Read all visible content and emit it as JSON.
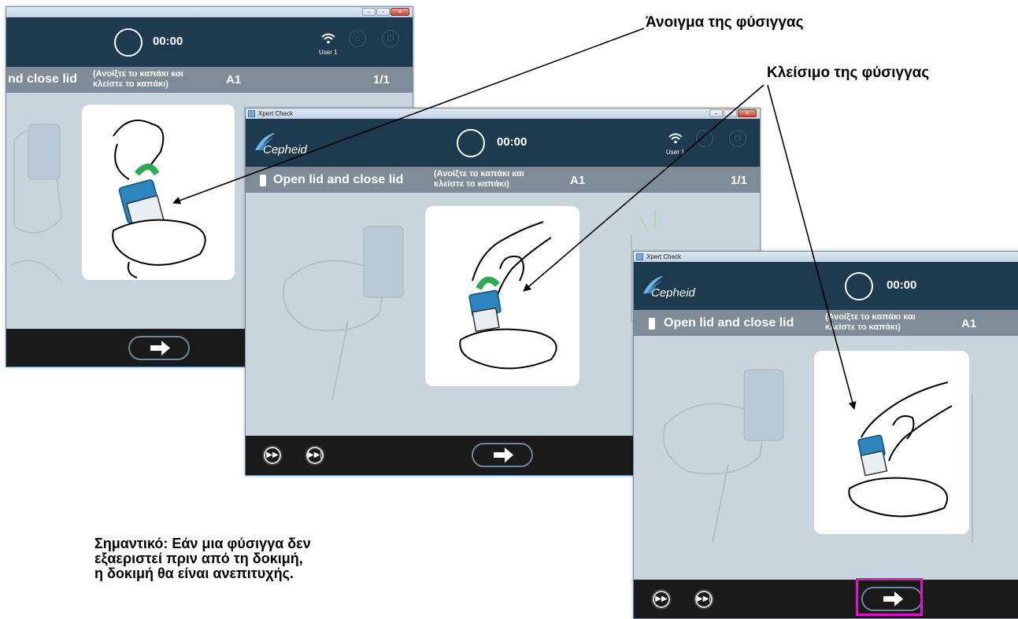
{
  "callouts": {
    "open_cartridge": "Άνοιγμα της φύσιγγας",
    "close_cartridge": "Κλείσιμο της φύσιγγας"
  },
  "note": {
    "line1": "Σημαντικό: Εάν μια φύσιγγα δεν",
    "line2": "εξαεριστεί πριν από τη δοκιμή,",
    "line3": "η δοκιμή θα είναι ανεπιτυχής."
  },
  "window_back": {
    "timer": "00:00",
    "user": "User 1",
    "step_main": "nd close lid",
    "step_greek_1": "(Ανοίξτε το καπάκι και",
    "step_greek_2": "κλείστε το καπάκι)",
    "position": "A1",
    "count": "1/1"
  },
  "window_middle": {
    "title": "Xpert Check",
    "brand": "Cepheid",
    "timer": "00:00",
    "user": "User 1",
    "step_main": "Open lid and close lid",
    "step_greek_1": "(Ανοίξτε το καπάκι και",
    "step_greek_2": "κλείστε το καπάκι)",
    "position": "A1",
    "count": "1/1"
  },
  "window_front": {
    "title": "Xpert Check",
    "brand": "Cepheid",
    "timer": "00:00",
    "step_main": "Open lid and close lid",
    "step_greek_1": "(Ανοίξτε το καπάκι και",
    "step_greek_2": "κλείστε το καπάκι)",
    "position": "A1"
  },
  "icons": {
    "next": "arrow-right-icon",
    "fast_forward": "fast-forward-icon",
    "skip_to_end": "skip-to-end-icon",
    "wifi": "wifi-icon",
    "home": "home-icon",
    "exit": "exit-icon"
  },
  "colors": {
    "header": "#1d3a4f",
    "step_bar": "#7d8c96",
    "body": "#c8d5dc",
    "footer": "#1a1a1a",
    "cartridge_blue": "#2e86c1",
    "lid_arrow_green": "#2eaa56",
    "highlight": "#e60ec9"
  }
}
